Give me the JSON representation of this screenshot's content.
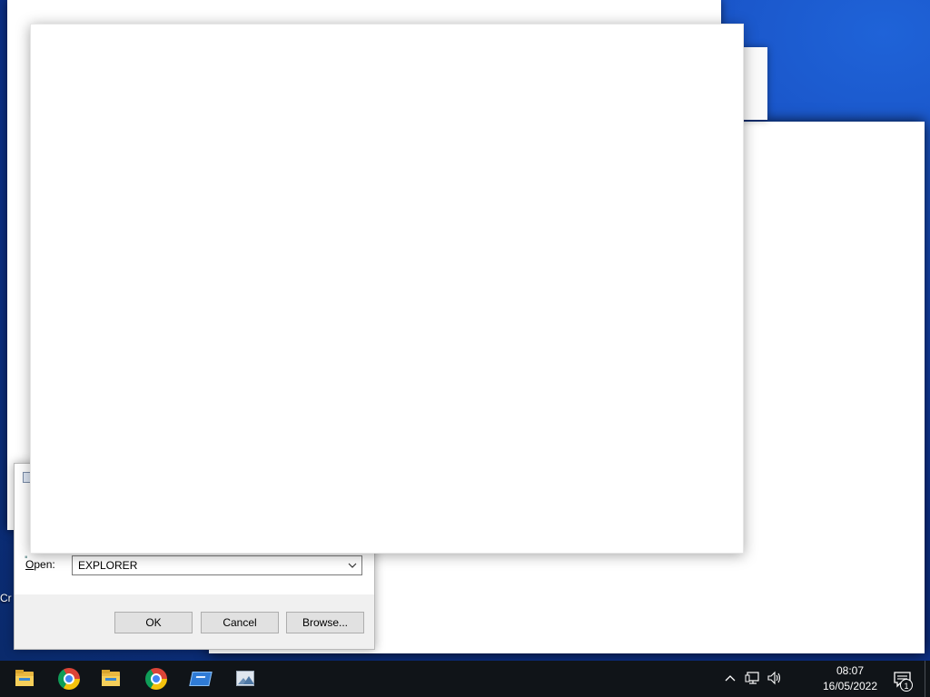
{
  "desktop": {
    "partial_label": "Cr"
  },
  "run_dialog": {
    "open_label_prefix": "",
    "open_label_accel": "O",
    "open_label_rest": "pen:",
    "open_value": "EXPLORER",
    "ok_label": "OK",
    "cancel_label": "Cancel",
    "browse_label": "Browse..."
  },
  "taskbar": {
    "icons": [
      "file-explorer-icon",
      "chrome-icon",
      "file-explorer-icon",
      "chrome-icon",
      "app-icon",
      "photo-viewer-icon"
    ]
  },
  "tray": {
    "time": "08:07",
    "date": "16/05/2022",
    "notification_count": "1"
  },
  "colors": {
    "taskbar": "#101418",
    "desktop_accent": "#1446b8",
    "dialog_bg": "#f0f0f0"
  }
}
